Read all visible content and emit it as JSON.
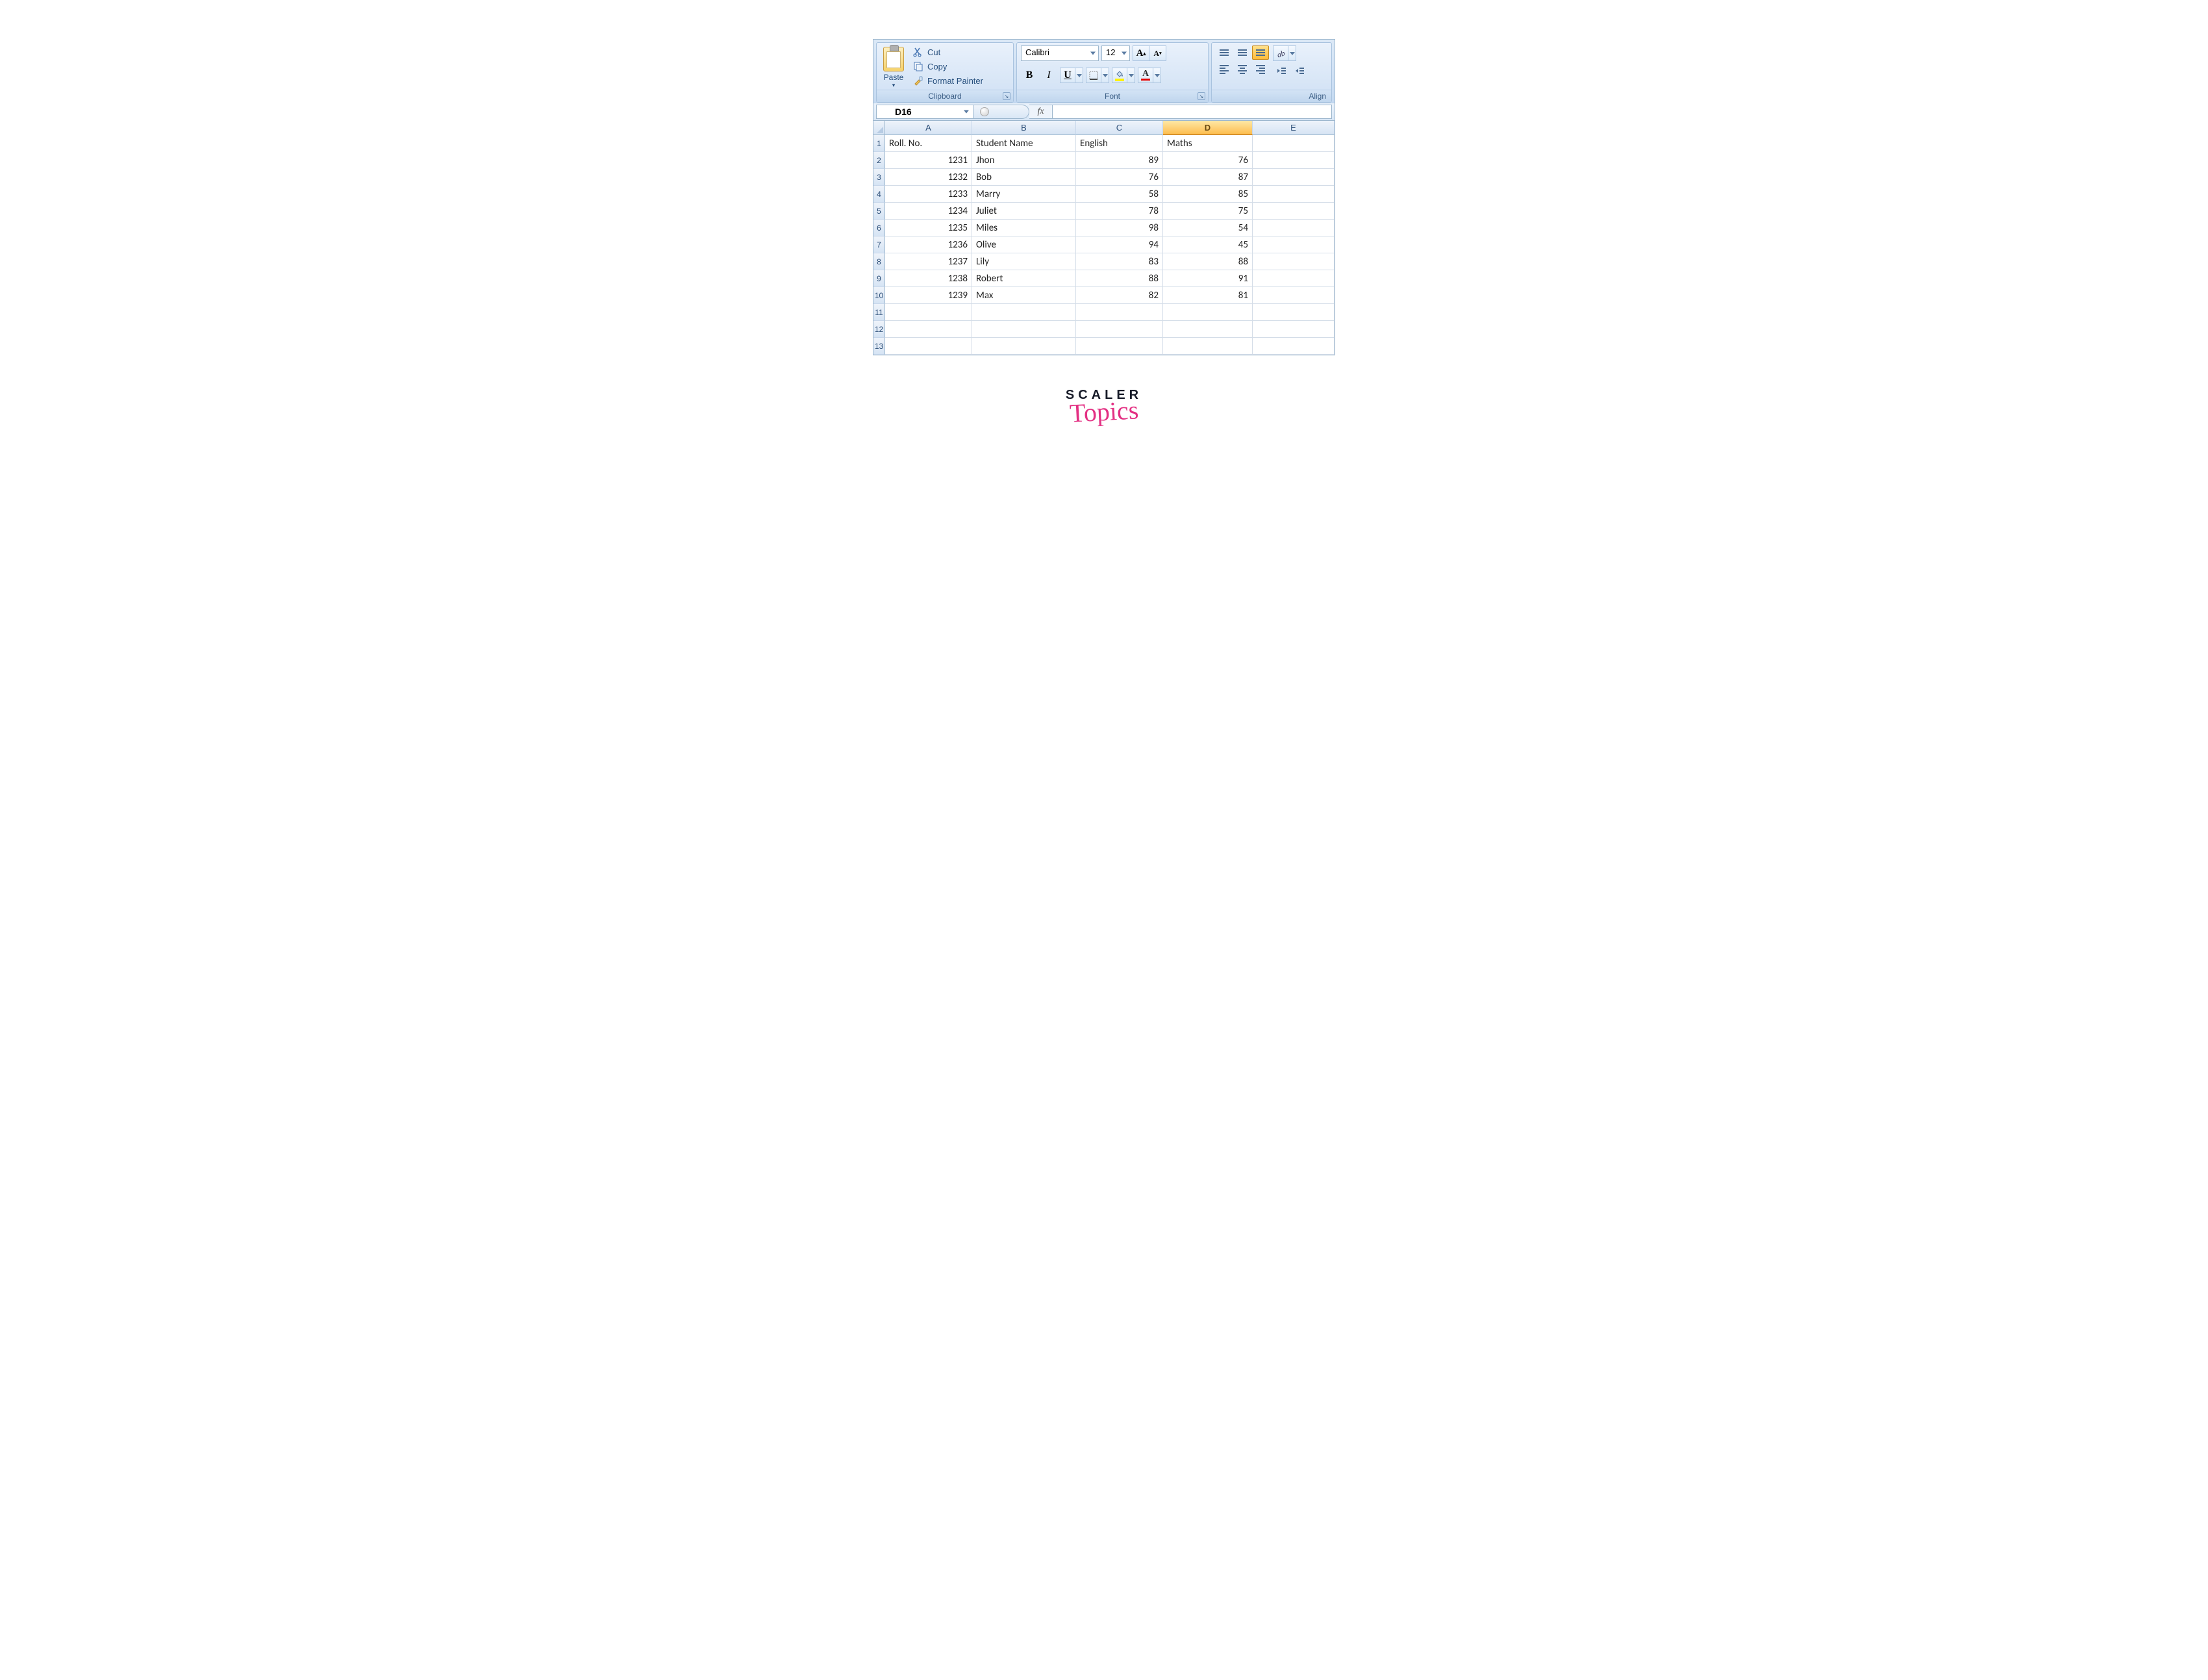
{
  "ribbon": {
    "clipboard": {
      "paste": "Paste",
      "cut": "Cut",
      "copy": "Copy",
      "formatPainter": "Format Painter",
      "label": "Clipboard"
    },
    "font": {
      "name": "Calibri",
      "size": "12",
      "label": "Font"
    },
    "align": {
      "label": "Align"
    }
  },
  "nameBox": "D16",
  "fx": "fx",
  "columns": [
    "A",
    "B",
    "C",
    "D",
    "E"
  ],
  "selectedColumn": "D",
  "rowHeaders": [
    "1",
    "2",
    "3",
    "4",
    "5",
    "6",
    "7",
    "8",
    "9",
    "10",
    "11",
    "12",
    "13"
  ],
  "headers": {
    "a": "Roll. No.",
    "b": "Student Name",
    "c": "English",
    "d": "Maths"
  },
  "rows": [
    {
      "roll": "1231",
      "name": "Jhon",
      "eng": "89",
      "math": "76"
    },
    {
      "roll": "1232",
      "name": "Bob",
      "eng": "76",
      "math": "87"
    },
    {
      "roll": "1233",
      "name": "Marry",
      "eng": "58",
      "math": "85"
    },
    {
      "roll": "1234",
      "name": "Juliet",
      "eng": "78",
      "math": "75"
    },
    {
      "roll": "1235",
      "name": "Miles",
      "eng": "98",
      "math": "54"
    },
    {
      "roll": "1236",
      "name": "Olive",
      "eng": "94",
      "math": "45"
    },
    {
      "roll": "1237",
      "name": "Lily",
      "eng": "83",
      "math": "88"
    },
    {
      "roll": "1238",
      "name": "Robert",
      "eng": "88",
      "math": "91"
    },
    {
      "roll": "1239",
      "name": "Max",
      "eng": "82",
      "math": "81"
    }
  ],
  "watermark": {
    "line1": "SCALER",
    "line2": "Topics"
  }
}
